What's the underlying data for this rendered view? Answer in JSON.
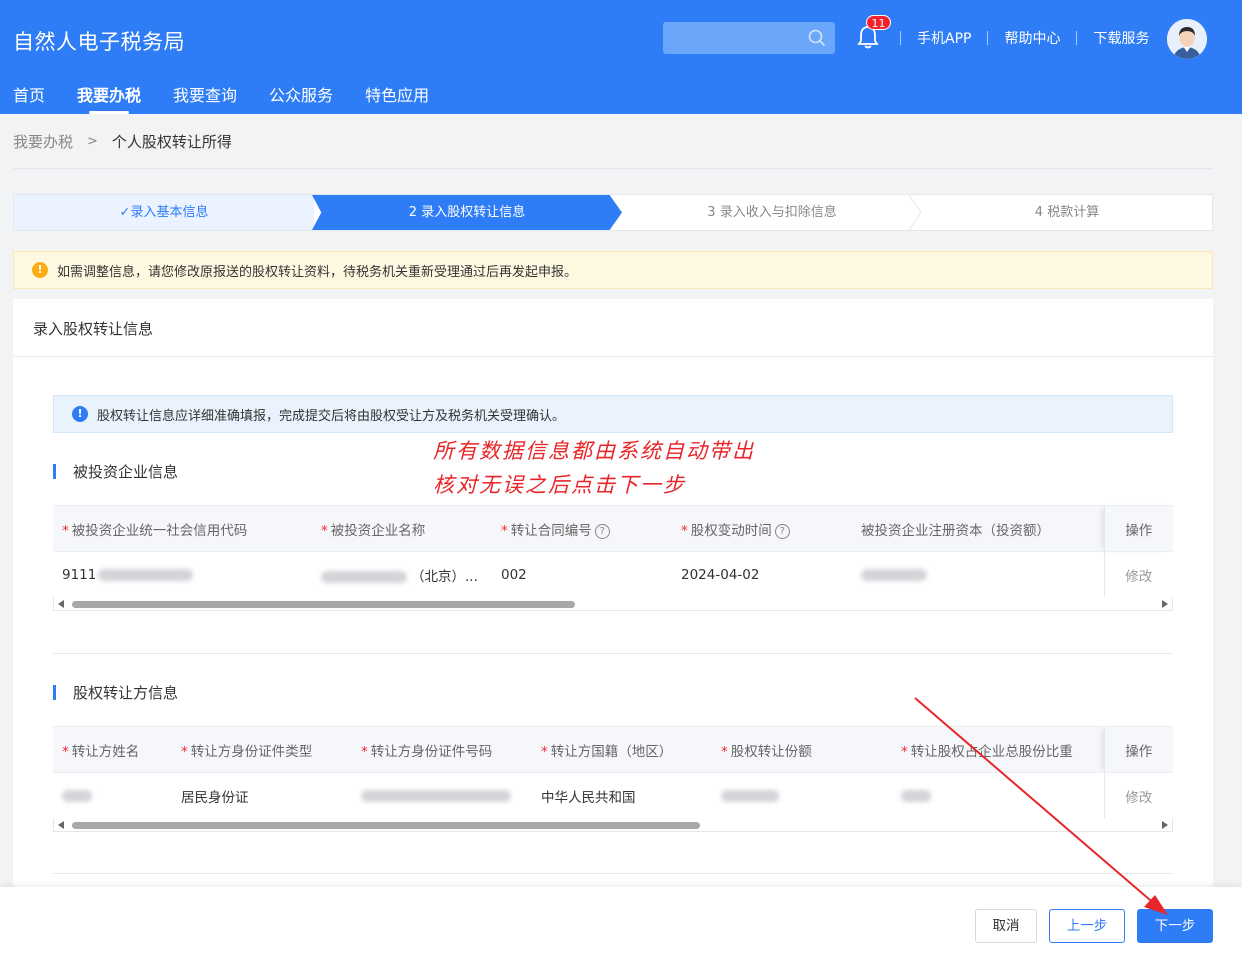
{
  "header": {
    "brand": "自然人电子税务局",
    "search": {
      "placeholder": "",
      "icon": "search-icon"
    },
    "notification_count": "11",
    "links": [
      "手机APP",
      "帮助中心",
      "下载服务"
    ]
  },
  "nav": {
    "items": [
      {
        "label": "首页",
        "active": false
      },
      {
        "label": "我要办税",
        "active": true
      },
      {
        "label": "我要查询",
        "active": false
      },
      {
        "label": "公众服务",
        "active": false
      },
      {
        "label": "特色应用",
        "active": false
      }
    ]
  },
  "breadcrumb": {
    "home": "我要办税",
    "separator": ">",
    "current": "个人股权转让所得"
  },
  "steps": [
    {
      "label": "✓录入基本信息",
      "state": "done"
    },
    {
      "label": "2  录入股权转让信息",
      "state": "active"
    },
    {
      "label": "3  录入收入与扣除信息",
      "state": "todo"
    },
    {
      "label": "4  税款计算",
      "state": "todo"
    }
  ],
  "alert": {
    "icon": "!",
    "text": "如需调整信息，请您修改原报送的股权转让资料，待税务机关重新受理通过后再发起申报。"
  },
  "card": {
    "title": "录入股权转让信息",
    "info": {
      "icon": "!",
      "text": "股权转让信息应详细准确填报，完成提交后将由股权受让方及税务机关受理确认。"
    },
    "annotation": [
      "所有数据信息都由系统自动带出",
      "核对无误之后点击下一步"
    ],
    "section1": {
      "title": "被投资企业信息",
      "columns": [
        "被投资企业统一社会信用代码",
        "被投资企业名称",
        "转让合同编号",
        "股权变动时间",
        "被投资企业注册资本（投资额）",
        "操作"
      ],
      "row": {
        "credit_code_prefix": "9111",
        "company_suffix": "（北京）...",
        "contract_no": "002",
        "change_date": "2024-04-02",
        "action": "修改"
      }
    },
    "section2": {
      "title": "股权转让方信息",
      "columns": [
        "转让方姓名",
        "转让方身份证件类型",
        "转让方身份证件号码",
        "转让方国籍（地区）",
        "股权转让份额",
        "转让股权占企业总股份比重",
        "操作"
      ],
      "row": {
        "id_type": "居民身份证",
        "nationality": "中华人民共和国",
        "action": "修改"
      }
    }
  },
  "footer": {
    "cancel": "取消",
    "prev": "上一步",
    "next": "下一步"
  },
  "colors": {
    "primary": "#2f7df6",
    "annotation": "#e8262a",
    "warning": "#faad14"
  }
}
